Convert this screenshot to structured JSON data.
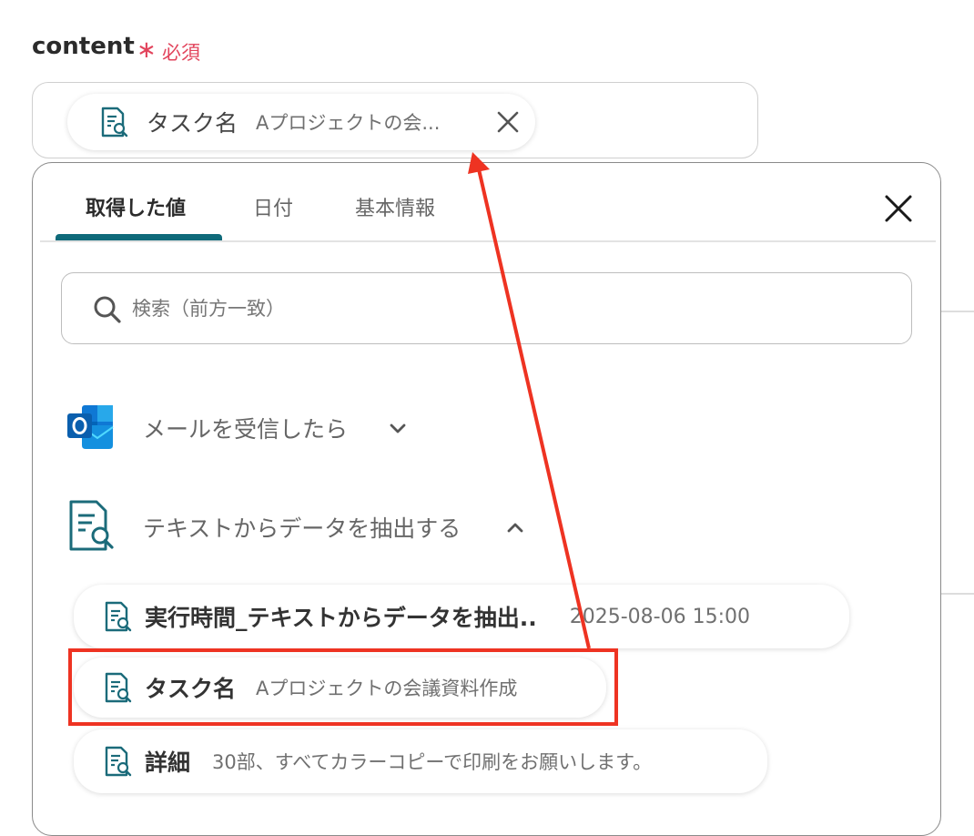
{
  "field": {
    "label": "content",
    "required_mark": "∗",
    "required_text": "必須"
  },
  "content_chip": {
    "title": "タスク名",
    "value": "Aプロジェクトの会..."
  },
  "panel": {
    "tabs": [
      {
        "label": "取得した値",
        "active": true
      },
      {
        "label": "日付",
        "active": false
      },
      {
        "label": "基本情報",
        "active": false
      }
    ],
    "search": {
      "placeholder": "検索（前方一致）",
      "value": ""
    },
    "sections": [
      {
        "label": "メールを受信したら",
        "icon": "outlook-icon",
        "expanded": false
      },
      {
        "label": "テキストからデータを抽出する",
        "icon": "document-search-icon",
        "expanded": true
      }
    ],
    "items": [
      {
        "title": "実行時間_テキストからデータを抽出..",
        "value": "2025-08-06 15:00"
      },
      {
        "title": "タスク名",
        "value": "Aプロジェクトの会議資料作成"
      },
      {
        "title": "詳細",
        "value": "30部、すべてカラーコピーで印刷をお願いします。"
      }
    ]
  },
  "colors": {
    "accent": "#0f6a7a",
    "required": "#e2445c",
    "annotation": "#ee3322"
  }
}
